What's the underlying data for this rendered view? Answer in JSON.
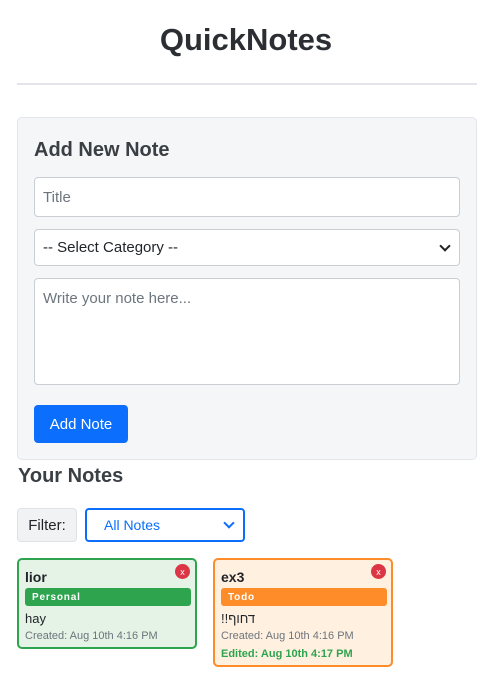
{
  "app": {
    "title": "QuickNotes"
  },
  "form": {
    "heading": "Add New Note",
    "title_placeholder": "Title",
    "category_selected": "-- Select Category --",
    "content_placeholder": "Write your note here...",
    "submit_label": "Add Note"
  },
  "notes_section": {
    "heading": "Your Notes",
    "filter_label": "Filter:",
    "filter_selected": "All Notes"
  },
  "notes": [
    {
      "title": "lior",
      "category": "Personal",
      "body": "hay",
      "created": "Created: Aug 10th 4:16 PM",
      "edited": "",
      "delete_label": "x"
    },
    {
      "title": "ex3",
      "category": "Todo",
      "body": "דחוף!!",
      "created": "Created: Aug 10th 4:16 PM",
      "edited": "Edited: Aug 10th 4:17 PM",
      "delete_label": "x"
    }
  ],
  "colors": {
    "accent": "#0b6efd",
    "personal": "#2ea44f",
    "todo": "#fd8c29",
    "danger": "#dc3545"
  }
}
